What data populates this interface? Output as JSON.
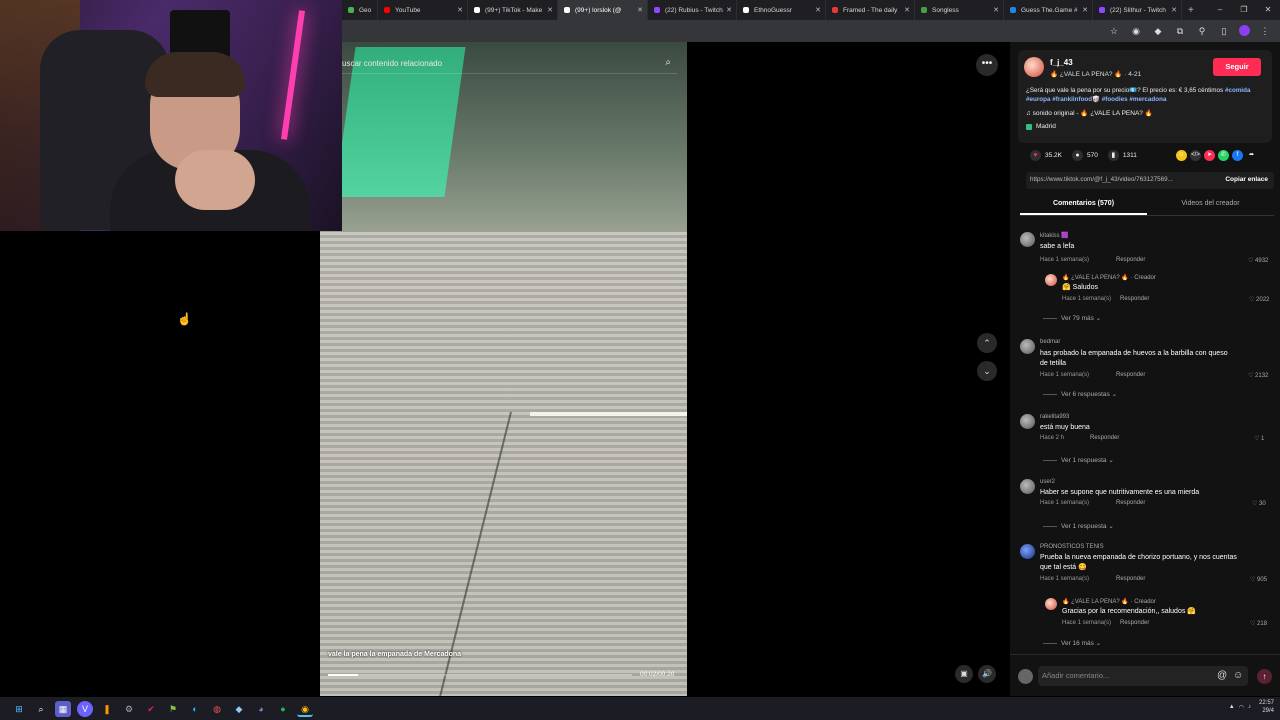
{
  "browser": {
    "tabs": [
      {
        "label": "Geo",
        "color": "#4caf50",
        "active": false
      },
      {
        "label": "YouTube",
        "color": "#ff0000",
        "active": false
      },
      {
        "label": "(99+) TikTok - Make",
        "color": "#ffffff",
        "active": false
      },
      {
        "label": "(99+) lorslok (@",
        "color": "#ffffff",
        "active": true
      },
      {
        "label": "(22) Rubius - Twitch",
        "color": "#9146ff",
        "active": false
      },
      {
        "label": "EthnoGuessr",
        "color": "#ffffff",
        "active": false
      },
      {
        "label": "Framed - The daily",
        "color": "#e53935",
        "active": false
      },
      {
        "label": "Songless",
        "color": "#43a047",
        "active": false
      },
      {
        "label": "Guess The.Game #",
        "color": "#1e88e5",
        "active": false
      },
      {
        "label": "(22) Slithur - Twitch",
        "color": "#9146ff",
        "active": false
      }
    ],
    "new_tab": "+",
    "window_controls": [
      "–",
      "❐",
      "✕"
    ]
  },
  "video": {
    "search_placeholder": "uscar contenido relacionado",
    "caption": "vale la pena la empanada de Mercadona",
    "time": "00:02/00:20",
    "progress": 0.1
  },
  "post": {
    "username": "f_j_43",
    "subtitle": "🔥 ¿VALE LA PENA? 🔥 · 4-21",
    "follow_label": "Seguir",
    "description": "¿Será que vale la pena por su precio💶? El precio es: € 3,65 céntimos",
    "hashtags": "#comida #europa #franklinfood🥡 #foodies #mercadona",
    "sound": "♫  sonido original - 🔥 ¿VALE LA PENA? 🔥",
    "location": "Madrid",
    "likes": "35.2K",
    "comments": "570",
    "saves": "1311",
    "url": "https://www.tiktok.com/@f_j_43/video/763127569...",
    "copy_label": "Copiar enlace",
    "tab_comments": "Comentarios (570)",
    "tab_videos": "Videos del creador"
  },
  "comments": [
    {
      "name": "kitakiss 🟪",
      "text": "sabe a lefa",
      "meta": "Hace 1 semana(s)",
      "reply": "Responder",
      "likes": "4932"
    },
    {
      "name": "🔥 ¿VALE LA PENA? 🔥 · Creador",
      "text": "🤗 Saludos",
      "meta": "Hace 1 semana(s)",
      "reply": "Responder",
      "likes": "2022"
    },
    {
      "more": "Ver 79 más ⌄"
    },
    {
      "name": "bedmar",
      "text": "has probado la empanada de huevos a la barbilla con queso de tetilla",
      "meta": "Hace 1 semana(s)",
      "reply": "Responder",
      "likes": "2132"
    },
    {
      "more": "Ver 6 respuestas ⌄"
    },
    {
      "name": "rakelita993",
      "text": "está muy buena",
      "meta": "Hace 2 h",
      "reply": "Responder",
      "likes": "1"
    },
    {
      "more": "Ver 1 respuesta ⌄"
    },
    {
      "name": "user2",
      "text": "Haber se supone que nutritivamente es una mierda",
      "meta": "Hace 1 semana(s)",
      "reply": "Responder",
      "likes": "30"
    },
    {
      "more": "Ver 1 respuesta ⌄"
    },
    {
      "name": "PRONOSTICOS TENIS",
      "text": "Prueba la nueva empanada de chorizo portuano, y nos cuentas que tal está 😋",
      "meta": "Hace 1 semana(s)",
      "reply": "Responder",
      "likes": "905"
    },
    {
      "name": "🔥 ¿VALE LA PENA? 🔥 · Creador",
      "text": "Gracias por la recomendación,, saludos 🤗",
      "meta": "Hace 1 semana(s)",
      "reply": "Responder",
      "likes": "218"
    },
    {
      "more": "Ver 16 más ⌄"
    }
  ],
  "add_comment_placeholder": "Añadir comentario...",
  "taskbar": {
    "time": "22:57",
    "date": "29/4"
  }
}
